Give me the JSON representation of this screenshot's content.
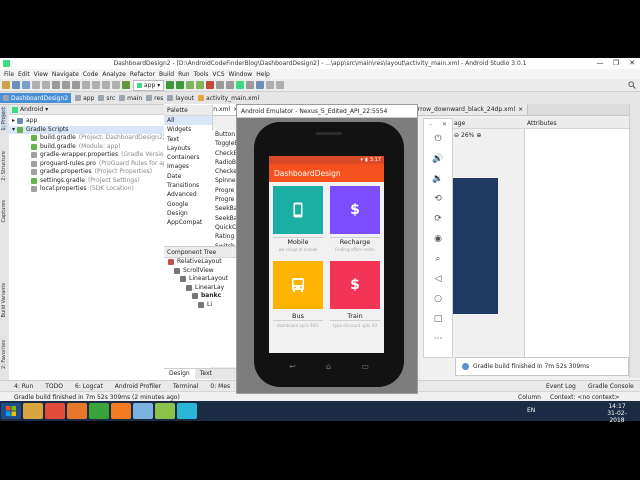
{
  "window": {
    "title": "DashboardDesign2 - [D:\\AndroidCodeFinderBlog\\DashboardDesign2] - ...\\app\\src\\main\\res\\layout\\activity_main.xml - Android Studio 3.0.1",
    "controls": [
      "—",
      "❐",
      "✕"
    ]
  },
  "menu": [
    "File",
    "Edit",
    "View",
    "Navigate",
    "Code",
    "Analyze",
    "Refactor",
    "Build",
    "Run",
    "Tools",
    "VCS",
    "Window",
    "Help"
  ],
  "toolbar": {
    "run_config": "app"
  },
  "breadcrumbs": [
    "DashboardDesign2",
    "app",
    "src",
    "main",
    "res",
    "layout",
    "activity_main.xml"
  ],
  "editor_tabs": [
    {
      "label": "activity_main.xml",
      "active": true
    },
    {
      "label": "activity_main.xml",
      "active": false
    },
    {
      "label": "ic_arrow_downward_black_24dp.xml",
      "active": false
    }
  ],
  "project": {
    "view_selector": "Android",
    "items": [
      {
        "label": "app",
        "note": "",
        "level": 0
      },
      {
        "label": "Gradle Scripts",
        "note": "",
        "level": 0
      },
      {
        "label": "build.gradle",
        "note": "(Project: DashboardDesign2)",
        "level": 1
      },
      {
        "label": "build.gradle",
        "note": "(Module: app)",
        "level": 1
      },
      {
        "label": "gradle-wrapper.properties",
        "note": "(Gradle Version)",
        "level": 1
      },
      {
        "label": "proguard-rules.pro",
        "note": "(ProGuard Rules for app)",
        "level": 1
      },
      {
        "label": "gradle.properties",
        "note": "(Project Properties)",
        "level": 1
      },
      {
        "label": "settings.gradle",
        "note": "(Project Settings)",
        "level": 1
      },
      {
        "label": "local.properties",
        "note": "(SDK Location)",
        "level": 1
      }
    ]
  },
  "left_strip": [
    "1: Project",
    "2: Structure",
    "Captures",
    "Build Variants",
    "2: Favorites"
  ],
  "palette": {
    "title": "Palette",
    "categories": [
      "All",
      "Widgets",
      "Text",
      "Layouts",
      "Containers",
      "Images",
      "Date",
      "Transitions",
      "Advanced",
      "Google",
      "Design",
      "AppCompat"
    ],
    "items": [
      "Button",
      "ToggleB",
      "CheckB",
      "RadioB",
      "CheckedT",
      "Spinner",
      "Progre",
      "Progre",
      "SeekBa",
      "SeekBa",
      "QuickC",
      "Rating",
      "Switch"
    ]
  },
  "component_tree": {
    "title": "Component Tree",
    "items": [
      {
        "label": "RelativeLayout",
        "level": 0
      },
      {
        "label": "ScrollView",
        "level": 1
      },
      {
        "label": "LinearLayout",
        "level": 2
      },
      {
        "label": "LinearLay",
        "level": 3
      },
      {
        "label": "bankc",
        "level": 4
      },
      {
        "label": "Li",
        "level": 5
      }
    ],
    "tabs": [
      "Design",
      "Text"
    ]
  },
  "design": {
    "zoom": "26%",
    "attributes_title": "Attributes",
    "partial_label": "age"
  },
  "emulator": {
    "title": "Android Emulator - Nexus_5_Edited_API_22:5554",
    "time": "3:17",
    "app_title": "DashboardDesign",
    "cards": [
      {
        "label": "Mobile",
        "sub": "we range of mobile",
        "color": "#1aaea4",
        "icon": "phone-icon"
      },
      {
        "label": "Recharge",
        "sub": "Finding offers recha",
        "color": "#7c4dff",
        "icon": "dollar-icon"
      },
      {
        "label": "Bus",
        "sub": "dashboard api's 90%",
        "color": "#ffb300",
        "icon": "bus-icon"
      },
      {
        "label": "Train",
        "sub": "type discount upto 50",
        "color": "#f23557",
        "icon": "dollar-icon"
      }
    ]
  },
  "notification": "Gradle build finished in 7m 52s 309ms",
  "bottom_tools": [
    "4: Run",
    "TODO",
    "6: Logcat",
    "Android Profiler",
    "Terminal",
    "0: Mes",
    "Event Log",
    "Gradle Console"
  ],
  "status": {
    "message": "Gradle build finished in 7m 52s 309ms (2 minutes ago)",
    "position": "Column",
    "context": "Context: <no context>"
  },
  "taskbar": {
    "lang": "EN",
    "time": "14:17",
    "date": "31-02-2018",
    "apps": [
      "windows-start-icon",
      "folder-icon",
      "chrome-icon",
      "firefox-icon",
      "camtasia-icon",
      "xampp-icon",
      "notepad-icon",
      "android-studio-icon",
      "nox-icon"
    ]
  },
  "colors": {
    "accent": "#f4511e",
    "status": "#d94a27"
  }
}
